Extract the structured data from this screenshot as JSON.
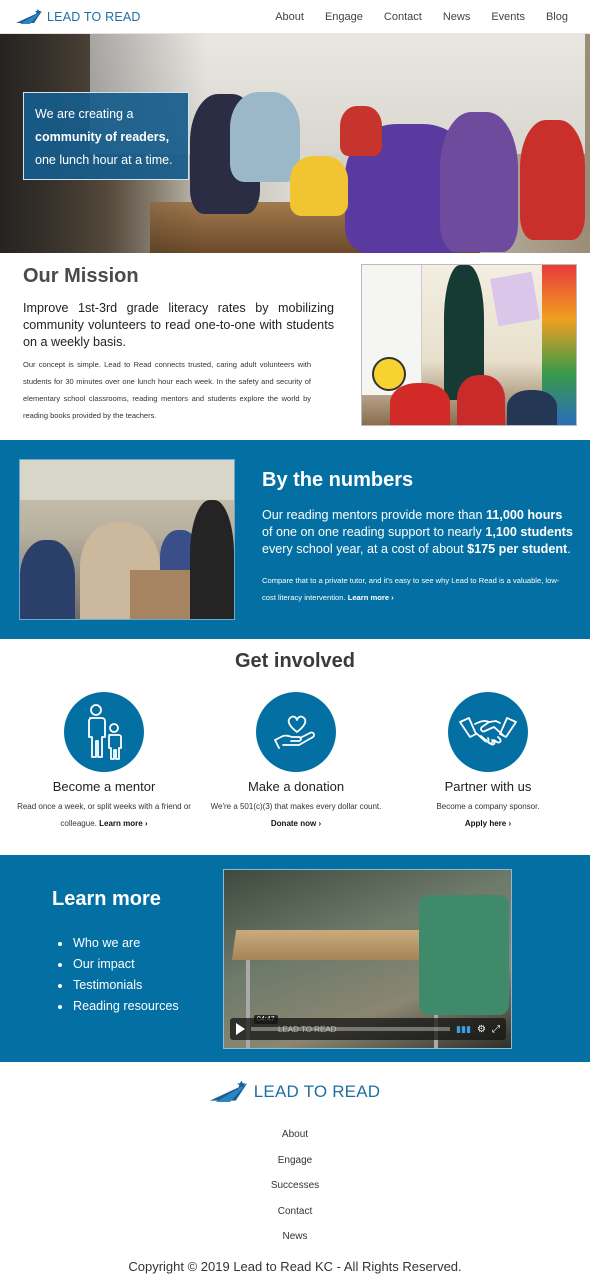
{
  "brand": {
    "name": "LEAD TO READ",
    "color": "#1f6fa3",
    "accent": "#046fa3"
  },
  "nav": {
    "items": [
      "About",
      "Engage",
      "Contact",
      "News",
      "Events",
      "Blog"
    ]
  },
  "hero": {
    "line1": "We are creating a",
    "line2": "community of readers,",
    "line3": "one lunch hour at a time."
  },
  "mission": {
    "title": "Our Mission",
    "lead": "Improve 1st-3rd grade literacy rates by mobilizing community volunteers to read one-to-one with students on a weekly basis.",
    "body": "Our concept is simple. Lead to Read connects trusted, caring adult volunteers with students for 30 minutes over one lunch hour each week. In the safety and security of elementary school classrooms, reading mentors and students explore the world by reading books provided by the teachers."
  },
  "numbers": {
    "title": "By the numbers",
    "lead_a": "Our reading mentors provide more than ",
    "lead_b": "11,000 hours",
    "lead_c": " of one on one reading support to nearly ",
    "lead_d": "1,100 students",
    "lead_e": " every school year, at a cost of about ",
    "lead_f": "$175 per student",
    "lead_g": ".",
    "small": "Compare that to a private tutor, and it's easy to see why Lead to Read is a valuable, low-cost literacy intervention. ",
    "small_link": "Learn more ›"
  },
  "get_involved": {
    "title": "Get involved",
    "cards": [
      {
        "icon": "parent-child-icon",
        "title": "Become a mentor",
        "text": "Read once a week, or split weeks with a friend or colleague. ",
        "link": "Learn more ›"
      },
      {
        "icon": "heart-hand-icon",
        "title": "Make a donation",
        "text": "We're a 501(c)(3) that makes every dollar count. ",
        "link": "Donate now ›"
      },
      {
        "icon": "handshake-icon",
        "title": "Partner with us",
        "text": "Become a company sponsor.",
        "link": "Apply here ›"
      }
    ]
  },
  "learn_more": {
    "title": "Learn more",
    "items": [
      "Who we are",
      "Our impact",
      "Testimonials",
      "Reading resources"
    ],
    "video": {
      "time": "04:47",
      "watermark": "LEAD TO READ"
    }
  },
  "footer": {
    "links": [
      "About",
      "Engage",
      "Successes",
      "Contact",
      "News"
    ],
    "copyright": "Copyright © 2019 Lead to Read KC - All Rights Reserved."
  }
}
